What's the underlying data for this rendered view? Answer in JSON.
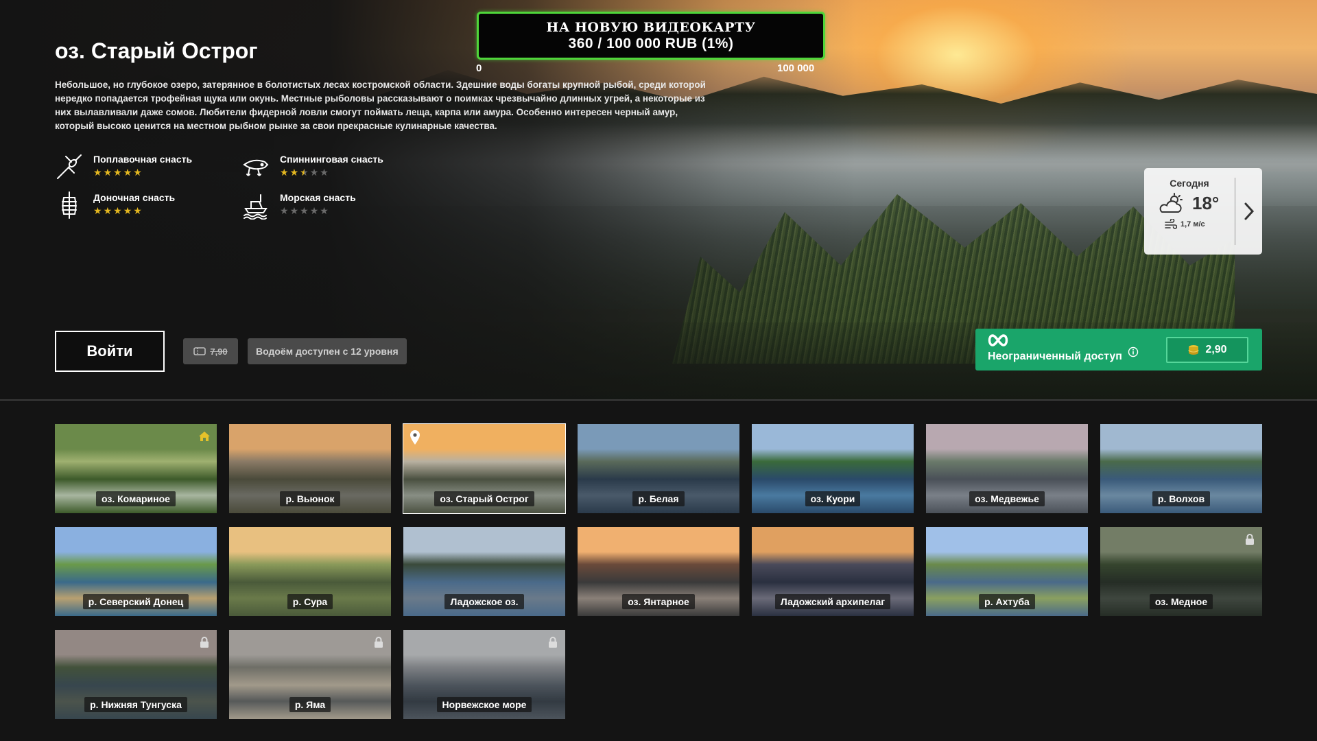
{
  "location": {
    "title": "оз. Старый Острог",
    "description": "Небольшое, но глубокое озеро, затерянное в болотистых лесах костромской области. Здешние воды богаты крупной рыбой, среди которой нередко попадается трофейная щука или окунь. Местные рыболовы рассказывают о поимках чрезвычайно длинных угрей, а некоторые из них вылавливали даже сомов. Любители фидерной ловли смогут поймать леща, карпа или амура. Особенно интересен черный амур, который высоко ценится на местном рыбном рынке за свои прекрасные кулинарные качества."
  },
  "gear": [
    {
      "name": "Поплавочная снасть",
      "icon": "float-rod-icon",
      "rating": 5,
      "max": 5
    },
    {
      "name": "Спиннинговая снасть",
      "icon": "spinning-lure-icon",
      "rating": 2.5,
      "max": 5
    },
    {
      "name": "Доночная снасть",
      "icon": "bottom-feeder-icon",
      "rating": 5,
      "max": 5
    },
    {
      "name": "Морская снасть",
      "icon": "sea-boat-icon",
      "rating": 0,
      "max": 5
    }
  ],
  "actions": {
    "enter_label": "Войти",
    "ticket_price": "7,90",
    "level_note": "Водоём доступен с 12 уровня"
  },
  "donation": {
    "line1": "НА НОВУЮ ВИДЕОКАРТУ",
    "line2": "360 / 100 000 RUB (1%)",
    "min_label": "0",
    "max_label": "100 000",
    "progress": 0.0036
  },
  "weather": {
    "day": "Сегодня",
    "temp": "18°",
    "wind": "1,7 м/с",
    "icon": "partly-cloudy-icon"
  },
  "unlimited": {
    "label": "Неограниченный доступ",
    "price": "2,90"
  },
  "colors": {
    "accent_green": "#1aa56a",
    "donation_border": "#4fd63a",
    "star_on": "#e5b820",
    "star_off": "#6a6a6a"
  },
  "locations": [
    {
      "name": "оз. Комариное",
      "badge": "home-icon"
    },
    {
      "name": "р. Вьюнок",
      "badge": ""
    },
    {
      "name": "оз. Старый Острог",
      "badge": "pin-icon",
      "selected": true
    },
    {
      "name": "р. Белая",
      "badge": ""
    },
    {
      "name": "оз. Куори",
      "badge": ""
    },
    {
      "name": "оз. Медвежье",
      "badge": ""
    },
    {
      "name": "р. Волхов",
      "badge": ""
    },
    {
      "name": "р. Северский Донец",
      "badge": ""
    },
    {
      "name": "р. Сура",
      "badge": ""
    },
    {
      "name": "Ладожское оз.",
      "badge": ""
    },
    {
      "name": "оз. Янтарное",
      "badge": ""
    },
    {
      "name": "Ладожский архипелаг",
      "badge": ""
    },
    {
      "name": "р. Ахтуба",
      "badge": ""
    },
    {
      "name": "оз. Медное",
      "badge": "lock-icon"
    },
    {
      "name": "р. Нижняя Тунгуска",
      "badge": "lock-icon"
    },
    {
      "name": "р. Яма",
      "badge": "lock-icon"
    },
    {
      "name": "Норвежское море",
      "badge": "lock-icon"
    }
  ]
}
